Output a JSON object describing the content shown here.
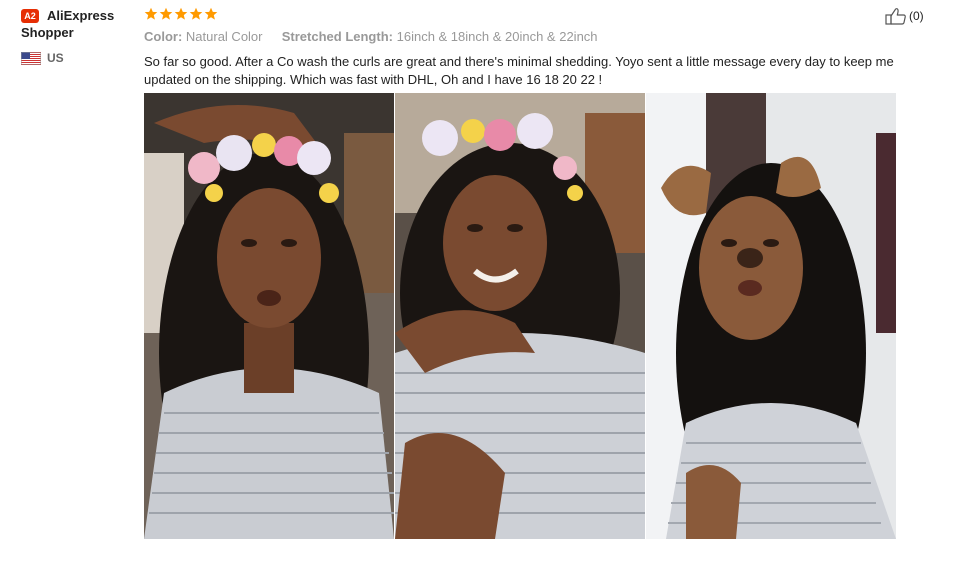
{
  "reviewer": {
    "badge": "A2",
    "name_line1": "AliExpress",
    "name_line2": "Shopper",
    "country": "US"
  },
  "rating": {
    "stars": 5,
    "max": 5,
    "color": "#ff9a00"
  },
  "attributes": [
    {
      "label": "Color:",
      "value": "Natural Color"
    },
    {
      "label": "Stretched Length:",
      "value": "16inch & 18inch & 20inch & 22inch"
    }
  ],
  "review_text": "So far so good. After a Co wash the curls are great and there's minimal shedding. Yoyo sent a little message every day to keep me updated on the shipping. Which was fast with DHL, Oh and I have 16 18 20 22 !",
  "helpful": {
    "count": "(0)",
    "icon": "thumbs-up-icon"
  },
  "photos": [
    {
      "name": "review-photo-1",
      "filter": "flower-crown"
    },
    {
      "name": "review-photo-2",
      "filter": "flower-crown"
    },
    {
      "name": "review-photo-3",
      "filter": "dog-ears"
    }
  ]
}
